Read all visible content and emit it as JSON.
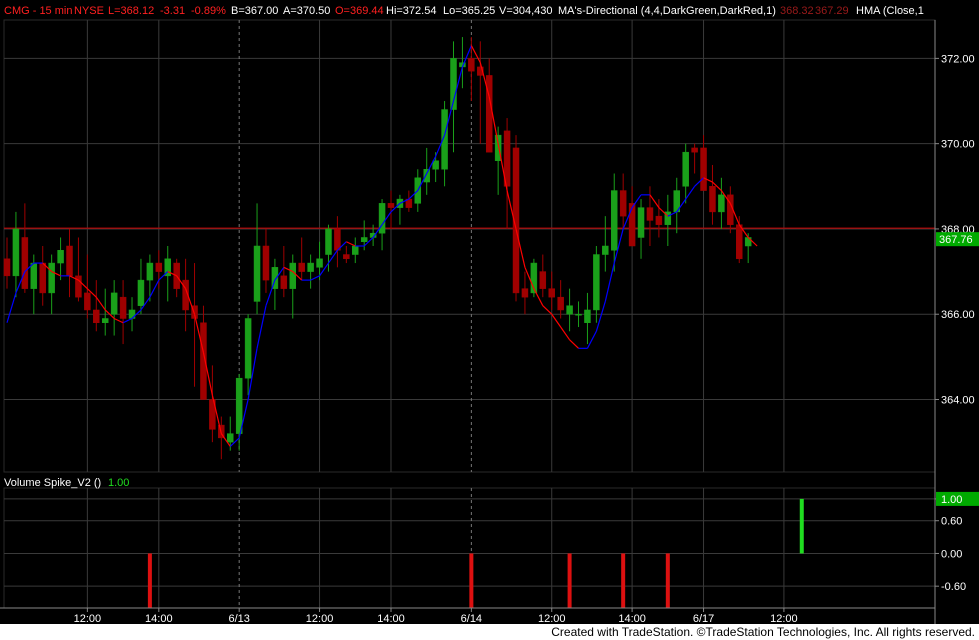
{
  "header": {
    "symbol": "CMG - 15 min",
    "exchange": "NYSE",
    "last": "L=368.12",
    "change": "-3.31",
    "change_pct": "-0.89%",
    "bid": "B=367.00",
    "ask": "A=370.50",
    "open": "O=369.44",
    "high": "Hi=372.54",
    "low": "Lo=365.25",
    "volume": "V=304,430",
    "ma_study": "MA's-Directional (4,4,DarkGreen,DarkRed,1)",
    "ma_val1": "368.32",
    "ma_val2": "367.29",
    "hma_study": "HMA (Close,1"
  },
  "lower_pane": {
    "title": "Volume Spike_V2 ()",
    "value": "1.00"
  },
  "footer": {
    "text": "Created with TradeStation. ©TradeStation Technologies, Inc. All rights reserved."
  },
  "colors": {
    "background": "#000000",
    "grid": "#3a3a3a",
    "up_candle": "#1aa01a",
    "down_candle": "#a00000",
    "ma_up": "#0000ff",
    "ma_down": "#ff0000",
    "price_label_bg": "#00aa00",
    "last_price_line": "#cc0000",
    "header_red": "#ff2020",
    "header_green": "#00dd00",
    "text": "#ffffff"
  },
  "chart_data": [
    {
      "type": "candlestick",
      "title": "CMG - 15 min",
      "y_ticks": [
        "372.00",
        "370.00",
        "368.00",
        "366.00",
        "364.00"
      ],
      "ylim": [
        362.3,
        372.9
      ],
      "last_price": "367.76",
      "x_labels": [
        "12:00",
        "14:00",
        "6/13",
        "12:00",
        "14:00",
        "6/14",
        "12:00",
        "14:00",
        "6/17",
        "12:00"
      ],
      "x_label_bar_index": [
        9,
        17,
        26,
        35,
        43,
        52,
        61,
        70,
        78,
        87
      ],
      "session_breaks": [
        26,
        52
      ],
      "grid": true,
      "candles": [
        [
          367.3,
          367.8,
          366.6,
          366.9
        ],
        [
          366.9,
          368.4,
          366.4,
          368.0
        ],
        [
          367.8,
          368.6,
          366.5,
          366.6
        ],
        [
          366.6,
          367.4,
          366.0,
          367.2
        ],
        [
          367.2,
          367.6,
          366.2,
          366.5
        ],
        [
          366.5,
          367.4,
          366.0,
          367.2
        ],
        [
          367.2,
          367.8,
          366.8,
          367.5
        ],
        [
          367.6,
          368.0,
          366.4,
          366.9
        ],
        [
          366.9,
          367.8,
          366.3,
          366.4
        ],
        [
          366.5,
          367.4,
          365.9,
          366.1
        ],
        [
          366.1,
          366.8,
          365.6,
          365.8
        ],
        [
          365.8,
          366.6,
          365.5,
          365.9
        ],
        [
          366.0,
          366.8,
          365.5,
          366.5
        ],
        [
          366.4,
          366.8,
          365.3,
          365.9
        ],
        [
          365.9,
          366.4,
          365.6,
          366.1
        ],
        [
          366.2,
          367.3,
          366.0,
          366.8
        ],
        [
          366.8,
          367.4,
          366.3,
          367.2
        ],
        [
          367.2,
          367.5,
          366.6,
          367.0
        ],
        [
          366.9,
          367.6,
          366.3,
          367.3
        ],
        [
          367.2,
          367.3,
          366.4,
          366.6
        ],
        [
          366.8,
          367.3,
          365.6,
          366.1
        ],
        [
          366.2,
          367.2,
          364.3,
          365.9
        ],
        [
          365.8,
          366.2,
          364.0,
          364.0
        ],
        [
          364.0,
          364.8,
          363.0,
          363.3
        ],
        [
          363.4,
          363.6,
          362.6,
          363.1
        ],
        [
          363.0,
          363.6,
          362.8,
          363.2
        ],
        [
          363.2,
          364.6,
          362.8,
          364.5
        ],
        [
          364.5,
          366.0,
          364.1,
          365.9
        ],
        [
          366.3,
          368.6,
          366.0,
          367.6
        ],
        [
          367.6,
          368.0,
          366.5,
          366.8
        ],
        [
          366.6,
          367.3,
          366.1,
          367.1
        ],
        [
          366.9,
          367.6,
          366.4,
          366.6
        ],
        [
          366.6,
          367.4,
          365.9,
          367.2
        ],
        [
          367.2,
          367.8,
          366.8,
          367.0
        ],
        [
          367.0,
          367.4,
          366.6,
          367.2
        ],
        [
          367.1,
          367.7,
          366.8,
          367.3
        ],
        [
          367.4,
          368.1,
          367.0,
          368.0
        ],
        [
          368.0,
          368.3,
          367.1,
          367.5
        ],
        [
          367.4,
          367.6,
          367.2,
          367.3
        ],
        [
          367.4,
          367.8,
          367.2,
          367.6
        ],
        [
          367.7,
          368.2,
          367.5,
          367.8
        ],
        [
          367.8,
          368.1,
          367.6,
          367.9
        ],
        [
          367.9,
          368.7,
          367.5,
          368.6
        ],
        [
          368.6,
          368.9,
          368.0,
          368.5
        ],
        [
          368.5,
          368.8,
          368.1,
          368.7
        ],
        [
          368.7,
          368.9,
          368.4,
          368.5
        ],
        [
          368.6,
          369.4,
          368.4,
          369.2
        ],
        [
          369.1,
          369.9,
          368.8,
          369.4
        ],
        [
          369.4,
          369.8,
          369.1,
          369.6
        ],
        [
          369.4,
          371.0,
          369.0,
          370.8
        ],
        [
          370.8,
          372.4,
          369.8,
          372.0
        ],
        [
          371.8,
          372.5,
          371.3,
          371.9
        ],
        [
          372.0,
          372.5,
          371.0,
          371.7
        ],
        [
          371.8,
          372.4,
          370.0,
          371.6
        ],
        [
          371.6,
          372.0,
          370.1,
          369.8
        ],
        [
          369.6,
          370.4,
          368.8,
          370.2
        ],
        [
          370.3,
          370.6,
          368.0,
          369.0
        ],
        [
          369.9,
          370.2,
          366.3,
          366.5
        ],
        [
          366.6,
          367.0,
          366.0,
          366.4
        ],
        [
          366.5,
          367.3,
          366.4,
          367.2
        ],
        [
          367.0,
          367.4,
          366.4,
          366.6
        ],
        [
          366.6,
          367.0,
          366.1,
          366.4
        ],
        [
          366.4,
          366.8,
          365.9,
          366.1
        ],
        [
          366.0,
          366.6,
          365.6,
          366.2
        ],
        [
          366.0,
          366.3,
          365.7,
          366.0
        ],
        [
          365.8,
          366.5,
          365.3,
          366.1
        ],
        [
          366.1,
          367.6,
          365.8,
          367.4
        ],
        [
          367.4,
          368.3,
          367.0,
          367.6
        ],
        [
          367.5,
          369.3,
          367.0,
          368.9
        ],
        [
          368.9,
          369.3,
          368.0,
          368.3
        ],
        [
          368.6,
          369.0,
          367.6,
          367.6
        ],
        [
          367.8,
          368.7,
          367.3,
          368.5
        ],
        [
          368.5,
          369.0,
          367.6,
          368.2
        ],
        [
          368.3,
          368.7,
          367.8,
          368.1
        ],
        [
          368.1,
          368.8,
          367.6,
          368.4
        ],
        [
          368.4,
          369.2,
          367.9,
          368.9
        ],
        [
          369.0,
          370.0,
          368.6,
          369.8
        ],
        [
          369.9,
          370.0,
          369.3,
          369.8
        ],
        [
          369.9,
          370.2,
          368.9,
          368.9
        ],
        [
          369.0,
          369.5,
          368.1,
          368.4
        ],
        [
          368.4,
          369.2,
          368.0,
          368.8
        ],
        [
          368.8,
          369.0,
          367.9,
          368.1
        ],
        [
          368.1,
          368.3,
          367.2,
          367.3
        ],
        [
          367.6,
          367.9,
          367.2,
          367.8
        ]
      ],
      "ma": [
        365.8,
        366.5,
        367.0,
        367.2,
        367.2,
        367.0,
        366.9,
        366.9,
        366.8,
        366.6,
        366.4,
        366.1,
        365.9,
        365.8,
        365.9,
        366.1,
        366.4,
        366.8,
        367.0,
        366.9,
        366.6,
        366.0,
        365.1,
        364.1,
        363.2,
        362.9,
        363.1,
        364.0,
        365.2,
        366.2,
        366.8,
        367.1,
        367.0,
        366.8,
        366.8,
        366.9,
        367.2,
        367.5,
        367.7,
        367.6,
        367.6,
        367.8,
        368.1,
        368.4,
        368.6,
        368.7,
        368.9,
        369.3,
        369.7,
        370.2,
        371.0,
        371.8,
        372.3,
        371.9,
        371.1,
        370.0,
        368.9,
        368.0,
        367.1,
        366.6,
        366.2,
        366.0,
        365.7,
        365.4,
        365.2,
        365.2,
        365.6,
        366.3,
        367.2,
        368.0,
        368.5,
        368.8,
        368.8,
        368.5,
        368.3,
        368.4,
        368.7,
        369.0,
        369.2,
        369.1,
        368.9,
        368.6,
        368.1,
        367.8,
        367.6
      ]
    },
    {
      "type": "bar",
      "title": "Volume Spike_V2 ()",
      "y_ticks": [
        "1.00",
        "0.60",
        "0.00",
        "-0.60"
      ],
      "ylim": [
        -1.0,
        1.2
      ],
      "bar_indices": [
        16,
        52,
        63,
        69,
        74,
        89
      ],
      "values": [
        -1,
        -1,
        -1,
        -1,
        -1,
        1
      ],
      "colors": [
        "#dd1010",
        "#dd1010",
        "#dd1010",
        "#dd1010",
        "#dd1010",
        "#20dd20"
      ]
    }
  ]
}
